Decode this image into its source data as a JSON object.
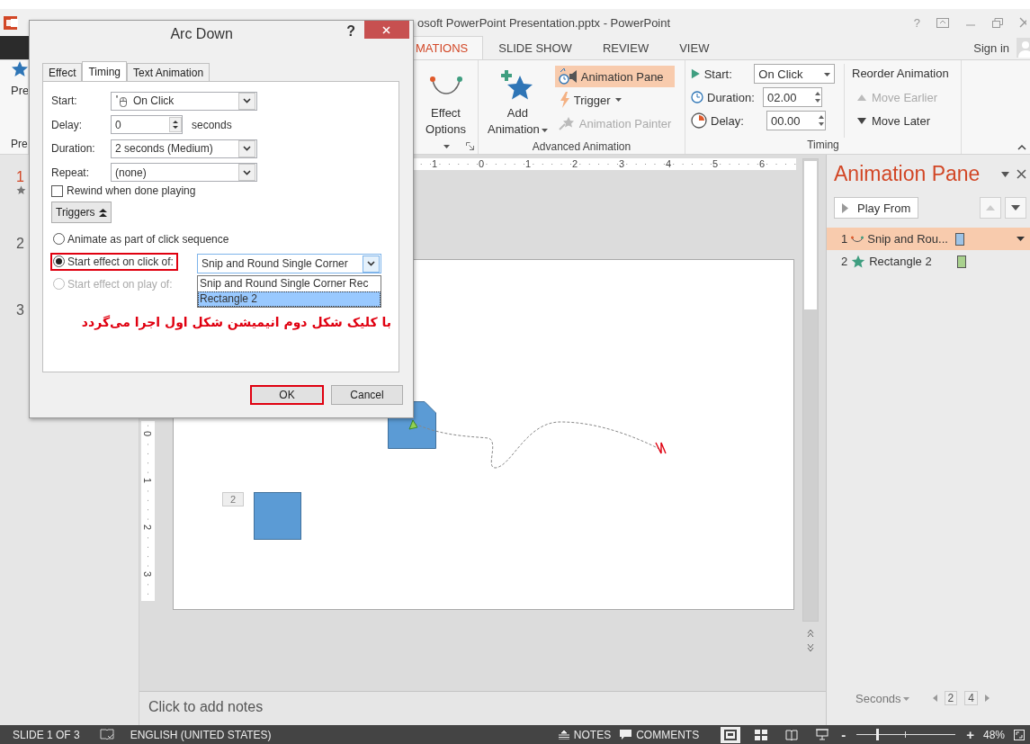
{
  "window": {
    "title": "osoft PowerPoint Presentation.pptx - PowerPoint",
    "help": "?"
  },
  "ribbon_tabs": [
    {
      "label": "MATIONS",
      "selected": true
    },
    {
      "label": "SLIDE SHOW",
      "selected": false
    },
    {
      "label": "REVIEW",
      "selected": false
    },
    {
      "label": "VIEW",
      "selected": false
    }
  ],
  "account": {
    "label": "Sign in"
  },
  "ribbon": {
    "preview": {
      "label": "Pre",
      "group_label": "Pre"
    },
    "effect_options": {
      "lines": [
        "Effect",
        "Options"
      ]
    },
    "add_animation": {
      "lines": [
        "Add",
        "Animation"
      ]
    },
    "advanced_items": [
      {
        "kind": "pane",
        "label": "Animation Pane",
        "highlighted": true,
        "dropdown": false,
        "disabled": false
      },
      {
        "kind": "trigger",
        "label": "Trigger",
        "highlighted": false,
        "dropdown": true,
        "disabled": false
      },
      {
        "kind": "painter",
        "label": "Animation Painter",
        "highlighted": false,
        "dropdown": false,
        "disabled": true
      }
    ],
    "advanced_group_label": "Advanced Animation",
    "timing_fields": [
      {
        "kind": "start",
        "label": "Start:",
        "value": "On Click"
      },
      {
        "kind": "duration",
        "label": "Duration:",
        "value": "02.00"
      },
      {
        "kind": "delay",
        "label": "Delay:",
        "value": "00.00"
      }
    ],
    "reorder": {
      "title": "Reorder Animation",
      "items": [
        {
          "kind": "up",
          "label": "Move Earlier",
          "disabled": true
        },
        {
          "kind": "down",
          "label": "Move Later",
          "disabled": false
        }
      ]
    },
    "timing_group_label": "Timing"
  },
  "slides": [
    {
      "number": "1",
      "selected": true,
      "animated": true
    },
    {
      "number": "2",
      "selected": false,
      "animated": false
    },
    {
      "number": "3",
      "selected": false,
      "animated": false
    }
  ],
  "rulers": {
    "horizontal": [
      "1",
      "0",
      "1",
      "2",
      "3",
      "4",
      "5",
      "6"
    ],
    "vertical": [
      "0",
      "1",
      "2",
      "3"
    ]
  },
  "slide": {
    "shapes": [
      {
        "kind": "snip"
      },
      {
        "kind": "rect",
        "tag": "2"
      }
    ]
  },
  "notes": {
    "placeholder": "Click to add notes"
  },
  "animation_pane": {
    "title": "Animation Pane",
    "play_button": "Play From",
    "items": [
      {
        "number": "1",
        "kind": "motion",
        "label": "Snip and Rou...",
        "selected": true,
        "color": "#9dc3e6"
      },
      {
        "number": "2",
        "kind": "entrance",
        "label": "Rectangle 2",
        "selected": false,
        "color": "#a9d18e"
      }
    ],
    "timeline": {
      "label": "Seconds",
      "start": "2",
      "end": "4"
    }
  },
  "dialog": {
    "title": "Arc Down",
    "help": "?",
    "tabs": [
      {
        "label": "Effect",
        "selected": false
      },
      {
        "label": "Timing",
        "selected": true
      },
      {
        "label": "Text Animation",
        "selected": false
      }
    ],
    "fields": [
      {
        "kind": "dropdown",
        "label": "Start:",
        "value": "On Click",
        "mouse_icon": true
      },
      {
        "kind": "spinner",
        "label": "Delay:",
        "value": "0",
        "suffix": "seconds"
      },
      {
        "kind": "dropdown",
        "label": "Duration:",
        "value": "2 seconds (Medium)",
        "mouse_icon": false
      },
      {
        "kind": "dropdown",
        "label": "Repeat:",
        "value": "(none)",
        "mouse_icon": false
      }
    ],
    "rewind": {
      "label": "Rewind when done playing",
      "checked": false
    },
    "triggers_button": "Triggers",
    "trigger_options": [
      {
        "label": "Animate as part of click sequence",
        "selected": false,
        "disabled": false,
        "annotated": false
      },
      {
        "label": "Start effect on click of:",
        "selected": true,
        "disabled": false,
        "annotated": true
      },
      {
        "label": "Start effect on play of:",
        "selected": false,
        "disabled": true,
        "annotated": false
      }
    ],
    "trigger_select": {
      "value": "Snip and Round Single Corner",
      "options": [
        {
          "label": "Snip and Round Single Corner Rec",
          "selected": false
        },
        {
          "label": "Rectangle 2",
          "selected": true
        }
      ]
    },
    "note": "با کلیک شکل دوم انیمیشن شکل اول اجرا می‌گردد",
    "buttons": [
      {
        "label": "OK",
        "annotated": true
      },
      {
        "label": "Cancel",
        "annotated": false
      }
    ]
  },
  "status_bar": {
    "slide": "SLIDE 1 OF 3",
    "language": "ENGLISH (UNITED STATES)",
    "notes": "NOTES",
    "comments": "COMMENTS",
    "views": [
      {
        "kind": "normal",
        "selected": true
      },
      {
        "kind": "sorter",
        "selected": false
      },
      {
        "kind": "reading",
        "selected": false
      },
      {
        "kind": "show",
        "selected": false
      }
    ],
    "zoom_out": "-",
    "zoom_in": "+",
    "zoom": {
      "level": 0.2
    },
    "zoom_label": "48%"
  }
}
